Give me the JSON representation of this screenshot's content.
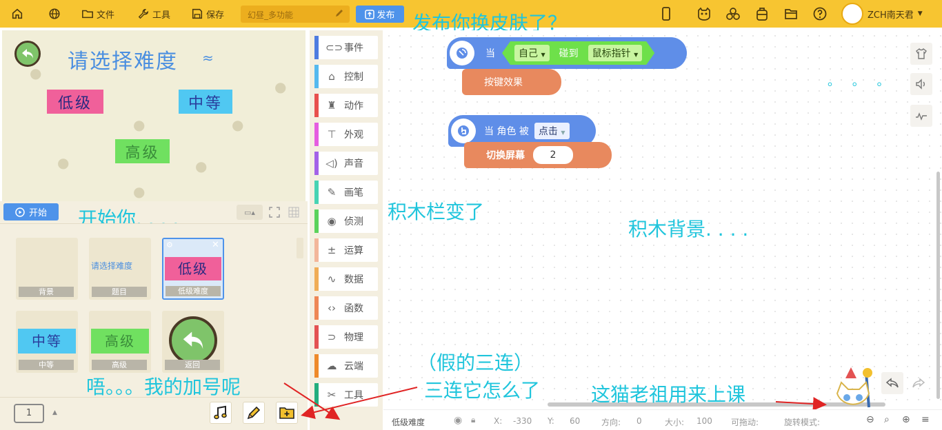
{
  "toolbar": {
    "file": "文件",
    "tools": "工具",
    "save": "保存",
    "project_title": "幻昼_多功能",
    "publish": "发布",
    "username": "ZCH南天君"
  },
  "annotations": {
    "publish_note": "发布你换皮肤了？",
    "start_note": "开始你. . . .",
    "palette_note": "积木栏变了",
    "bg_note": "积木背景. . . .",
    "dots": "。 。 。",
    "plus_note": "唔。。。我的加号呢",
    "triple_note": "（假的三连）",
    "triple_note2": "三连它怎么了",
    "cat_note": "这猫老祖用来上课",
    "arrow_color": "#e02424"
  },
  "stage": {
    "title": "请选择难度",
    "level_low": "低级",
    "level_mid": "中等",
    "level_high": "高级",
    "start": "开始"
  },
  "sprites": [
    {
      "label": "背景"
    },
    {
      "label": "题目",
      "preview": "请选择难度"
    },
    {
      "label": "低级难度",
      "preview": "低级"
    },
    {
      "label": "中等",
      "preview": "中等"
    },
    {
      "label": "高级",
      "preview": "高级"
    },
    {
      "label": "返回"
    }
  ],
  "bottom": {
    "page": "1"
  },
  "categories": [
    {
      "label": "事件",
      "color": "#4e7ce0"
    },
    {
      "label": "控制",
      "color": "#55b9ee"
    },
    {
      "label": "动作",
      "color": "#e8504d"
    },
    {
      "label": "外观",
      "color": "#e55de0"
    },
    {
      "label": "声音",
      "color": "#a361e8"
    },
    {
      "label": "画笔",
      "color": "#47d3b3"
    },
    {
      "label": "侦测",
      "color": "#5bd25b"
    },
    {
      "label": "运算",
      "color": "#f3b69a"
    },
    {
      "label": "数据",
      "color": "#f0ad56"
    },
    {
      "label": "函数",
      "color": "#ee8755"
    },
    {
      "label": "物理",
      "color": "#e35252"
    },
    {
      "label": "云端",
      "color": "#ee8a2a"
    },
    {
      "label": "工具",
      "color": "#22ae7d"
    }
  ],
  "blocks": {
    "when": "当",
    "self": "自己",
    "touch": "碰到",
    "mouse": "鼠标指针",
    "button_effect": "按键效果",
    "when_sprite": "当 角色 被",
    "clicked": "点击",
    "switch_screen": "切换屏幕",
    "screen_num": "2"
  },
  "status": {
    "sprite": "低级难度",
    "x_label": "X:",
    "x": "-330",
    "y_label": "Y:",
    "y": "60",
    "dir_label": "方向:",
    "dir": "0",
    "size_label": "大小:",
    "size": "100",
    "drag_label": "可拖动:",
    "rot_label": "旋转模式:"
  }
}
